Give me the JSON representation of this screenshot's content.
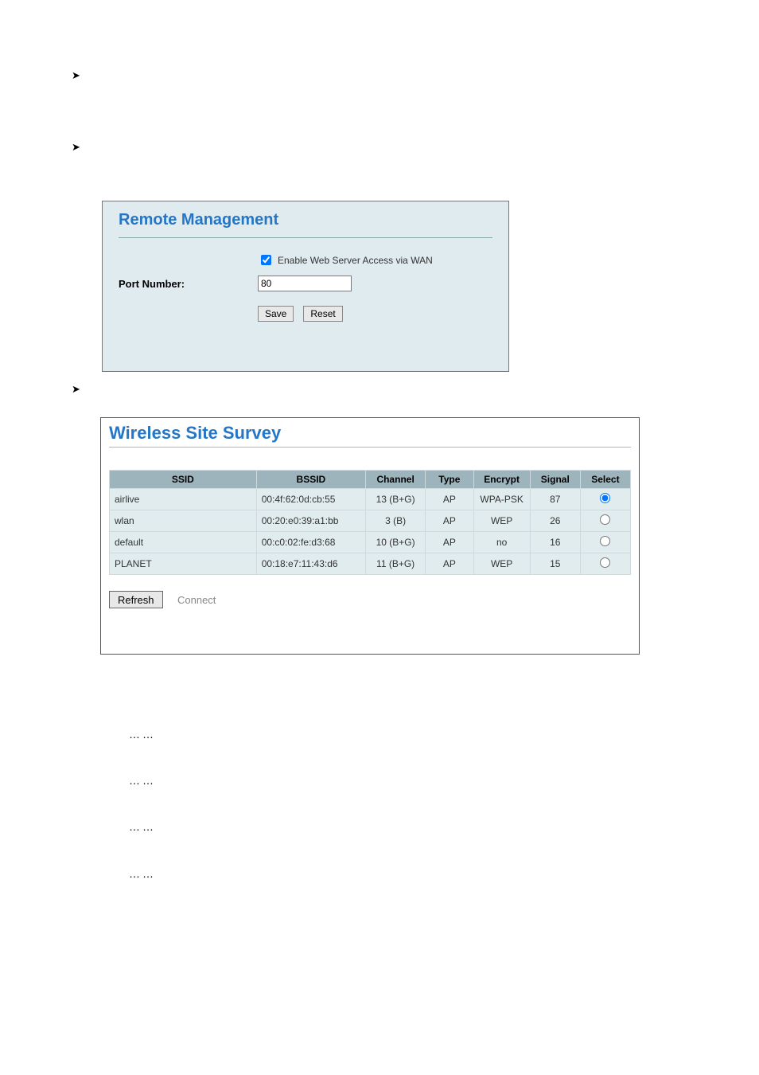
{
  "remote_management": {
    "title": "Remote Management",
    "label_port": "Port Number:",
    "checkbox_label": "Enable Web Server Access via WAN",
    "port_value": "80",
    "save_label": "Save",
    "reset_label": "Reset"
  },
  "wireless_survey": {
    "title": "Wireless Site Survey",
    "headers": {
      "ssid": "SSID",
      "bssid": "BSSID",
      "channel": "Channel",
      "type": "Type",
      "encrypt": "Encrypt",
      "signal": "Signal",
      "select": "Select"
    },
    "rows": [
      {
        "ssid": "airlive",
        "bssid": "00:4f:62:0d:cb:55",
        "channel": "13 (B+G)",
        "type": "AP",
        "encrypt": "WPA-PSK",
        "signal": "87",
        "selected": true
      },
      {
        "ssid": "wlan",
        "bssid": "00:20:e0:39:a1:bb",
        "channel": "3 (B)",
        "type": "AP",
        "encrypt": "WEP",
        "signal": "26",
        "selected": false
      },
      {
        "ssid": "default",
        "bssid": "00:c0:02:fe:d3:68",
        "channel": "10 (B+G)",
        "type": "AP",
        "encrypt": "no",
        "signal": "16",
        "selected": false
      },
      {
        "ssid": "PLANET",
        "bssid": "00:18:e7:11:43:d6",
        "channel": "11 (B+G)",
        "type": "AP",
        "encrypt": "WEP",
        "signal": "15",
        "selected": false
      }
    ],
    "refresh_label": "Refresh",
    "connect_label": "Connect"
  },
  "ellipses": [
    "……",
    "……",
    "……",
    "……"
  ]
}
